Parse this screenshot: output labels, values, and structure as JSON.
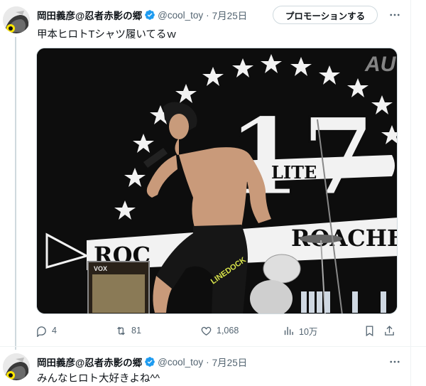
{
  "posts": [
    {
      "display_name": "岡田義彦@忍者赤影の郷",
      "handle": "@cool_toy",
      "separator": "·",
      "date": "7月25日",
      "promote_label": "プロモーションする",
      "text": "甲本ヒロトTシャツ履いてるｗ",
      "media": {
        "stage_text_1": "17",
        "stage_text_2": "ROC",
        "stage_text_3": "ROACHES",
        "stage_text_4": "LITE",
        "amp_label": "VOX",
        "shorts_text": "LINEDOCK",
        "channel_logo": "AU"
      },
      "stats": {
        "replies": "4",
        "retweets": "81",
        "likes": "1,068",
        "views": "10万"
      }
    },
    {
      "display_name": "岡田義彦@忍者赤影の郷",
      "handle": "@cool_toy",
      "separator": "·",
      "date": "7月25日",
      "text": "みんなヒロト大好きよね^^"
    }
  ],
  "colors": {
    "verified": "#1d9bf0",
    "muted": "#536471",
    "thread_line": "#cfd9de"
  }
}
